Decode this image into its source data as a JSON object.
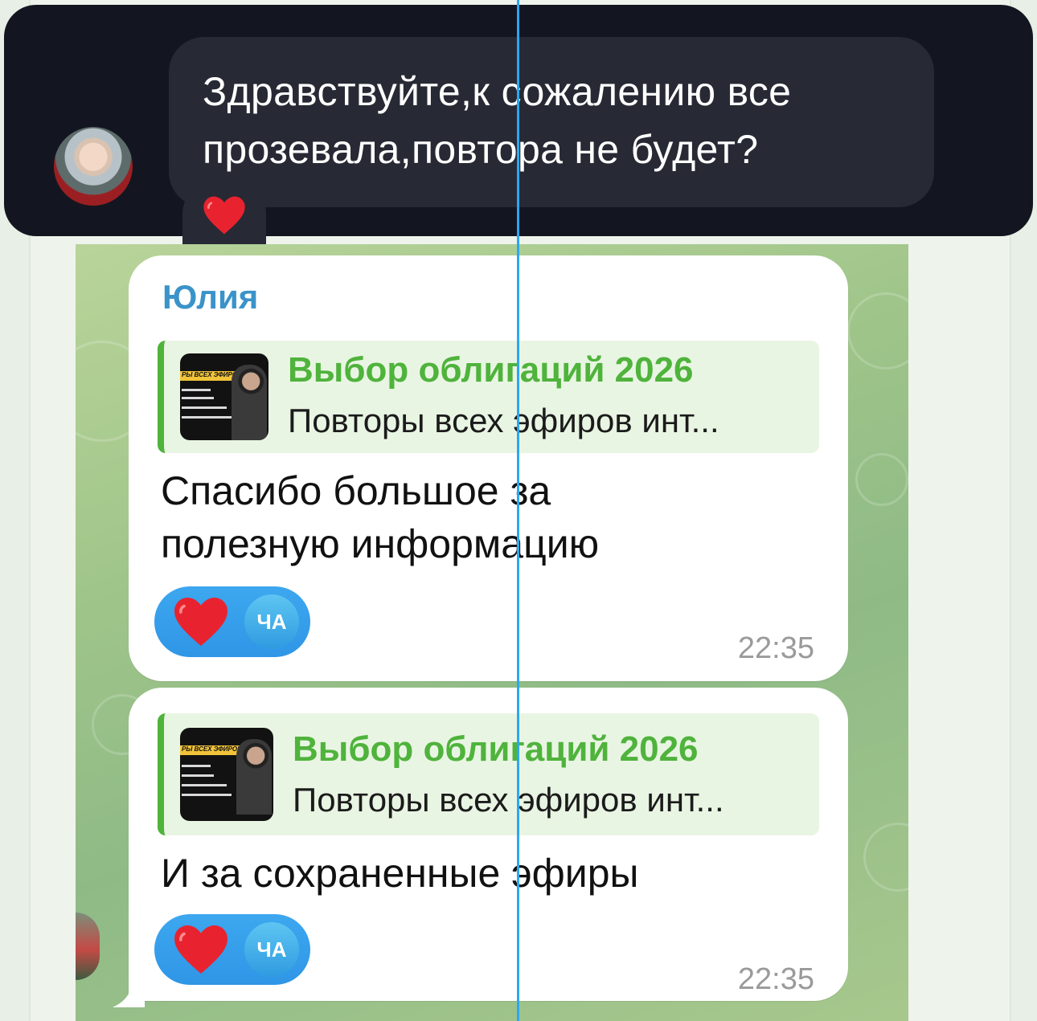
{
  "top_message": {
    "text_line1": "Здравствуйте,к сожалению все",
    "text_line2": "прозевала,повтора не будет?",
    "reaction_icon": "red-heart-icon"
  },
  "messages": [
    {
      "sender": "Юлия",
      "quote": {
        "title": "Выбор облигаций 2026",
        "subtitle": "Повторы всех эфиров инт...",
        "thumbnail_banner": "РЫ ВСЕХ ЭФИРОВ"
      },
      "text_line1": "Спасибо большое за",
      "text_line2": "полезную информацию",
      "reaction": {
        "icon": "red-heart-icon",
        "user_initials": "ЧА"
      },
      "time": "22:35"
    },
    {
      "quote": {
        "title": "Выбор облигаций 2026",
        "subtitle": "Повторы всех эфиров инт...",
        "thumbnail_banner": "РЫ ВСЕХ ЭФИРОВ"
      },
      "text": "И за сохраненные эфиры",
      "reaction": {
        "icon": "red-heart-icon",
        "user_initials": "ЧА"
      },
      "time": "22:35"
    }
  ],
  "colors": {
    "dark_card": "#131620",
    "dark_bubble": "#272a34",
    "sender_name": "#3a93c9",
    "quote_accent": "#4fb33c",
    "reaction_pill": "#3da7ef",
    "guide_line": "#2aa8f2"
  }
}
